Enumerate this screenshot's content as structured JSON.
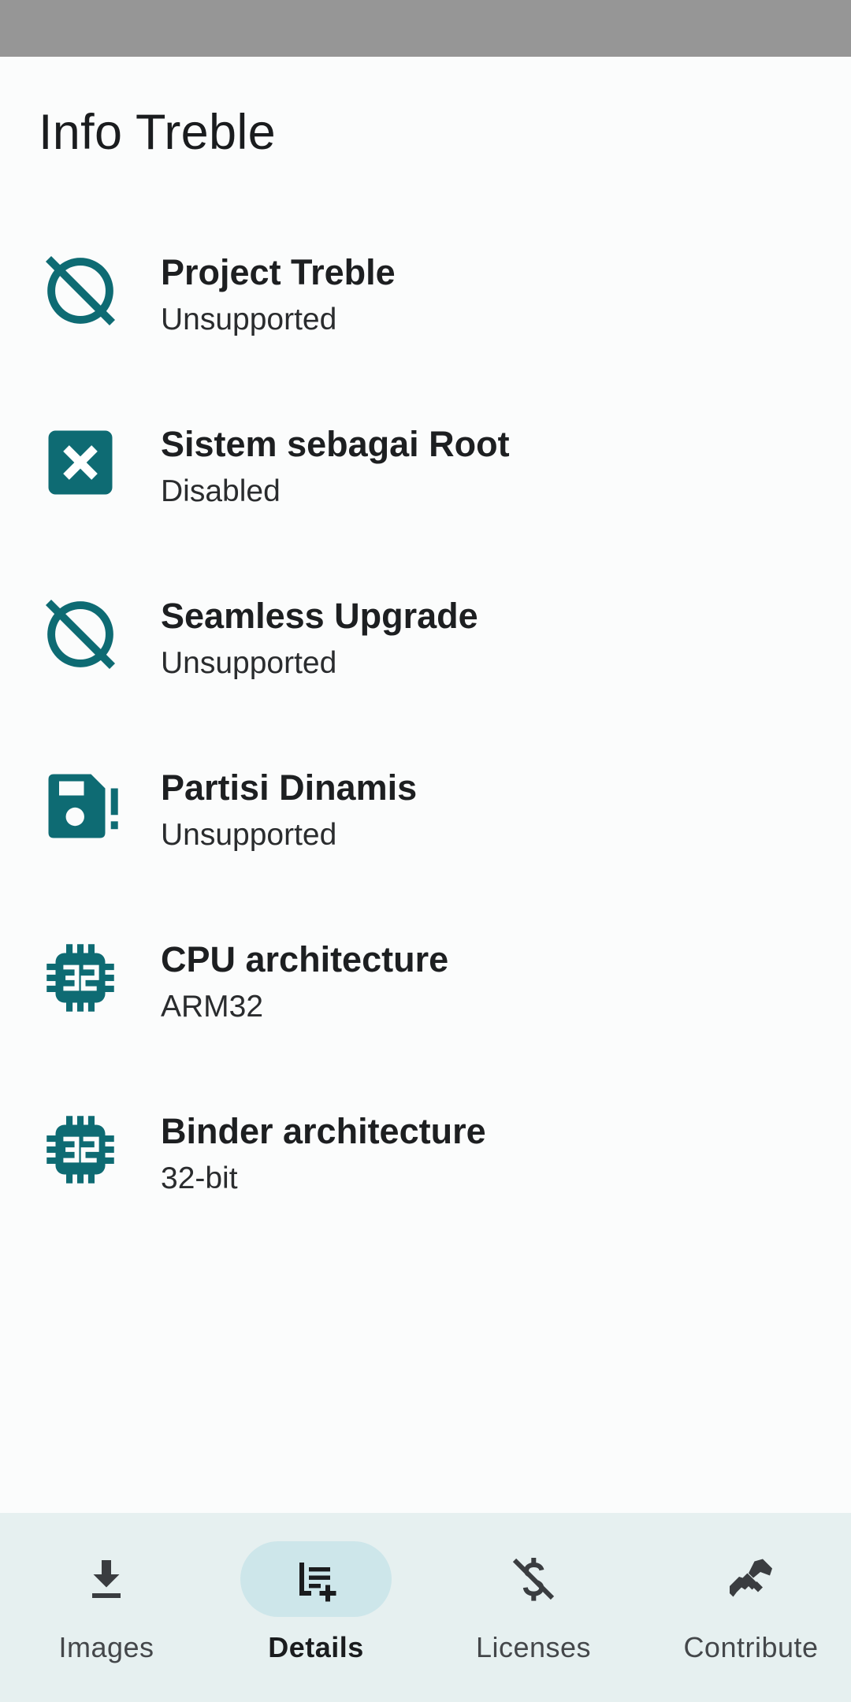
{
  "app": {
    "title": "Info Treble"
  },
  "colors": {
    "accent": "#0e6b73",
    "nav_background": "#e6f0f0",
    "nav_active_pill": "#cde6ea",
    "status_bar": "#969696"
  },
  "items": [
    {
      "icon": "block-icon",
      "title": "Project Treble",
      "subtitle": "Unsupported"
    },
    {
      "icon": "close-box-icon",
      "title": "Sistem sebagai Root",
      "subtitle": "Disabled"
    },
    {
      "icon": "block-icon",
      "title": "Seamless Upgrade",
      "subtitle": "Unsupported"
    },
    {
      "icon": "sd-card-alert-icon",
      "title": "Partisi Dinamis",
      "subtitle": "Unsupported"
    },
    {
      "icon": "chip-32-icon",
      "title": "CPU architecture",
      "subtitle": "ARM32"
    },
    {
      "icon": "chip-32-icon",
      "title": "Binder architecture",
      "subtitle": "32-bit"
    }
  ],
  "nav": [
    {
      "icon": "download-icon",
      "label": "Images",
      "active": false
    },
    {
      "icon": "playlist-add-icon",
      "label": "Details",
      "active": true
    },
    {
      "icon": "money-off-icon",
      "label": "Licenses",
      "active": false
    },
    {
      "icon": "handshake-icon",
      "label": "Contribute",
      "active": false
    }
  ]
}
